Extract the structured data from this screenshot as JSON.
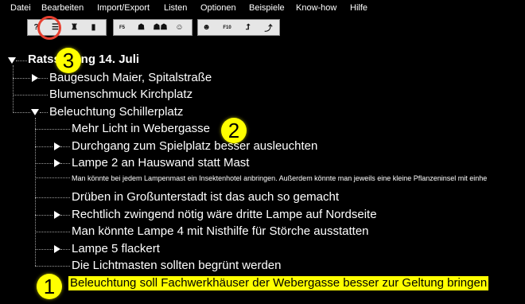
{
  "menu": [
    "Datei",
    "Bearbeiten",
    "Import/Export",
    "Listen",
    "Optionen",
    "Beispiele",
    "Know-how",
    "Hilfe"
  ],
  "toolbar": {
    "buttons": [
      {
        "name": "help-icon",
        "glyph": "?"
      },
      {
        "name": "list-view-icon",
        "glyph": "☰"
      },
      {
        "name": "tree-icon",
        "glyph": "♜"
      },
      {
        "name": "chart-icon",
        "glyph": "▮"
      },
      {
        "name": "f5-icon",
        "glyph": "F5"
      },
      {
        "name": "person-icon",
        "glyph": "☗"
      },
      {
        "name": "persons-icon",
        "glyph": "☗☗"
      },
      {
        "name": "face-icon",
        "glyph": "☺"
      },
      {
        "name": "portrait-icon",
        "glyph": "☻"
      },
      {
        "name": "f10-icon",
        "glyph": "F10"
      },
      {
        "name": "up-arrow-icon",
        "glyph": "⮥"
      },
      {
        "name": "tree-branch-icon",
        "glyph": "⤴"
      }
    ]
  },
  "tree": {
    "root": "Ratssitzung 14. Juli",
    "items": [
      {
        "label": "Baugesuch Maier, Spitalstraße"
      },
      {
        "label": "Blumenschmuck Kirchplatz"
      },
      {
        "label": "Beleuchtung Schillerplatz"
      },
      {
        "label": "Mehr Licht in Webergasse"
      },
      {
        "label": "Durchgang zum Spielplatz besser ausleuchten"
      },
      {
        "label": "Lampe 2 an Hauswand statt Mast"
      },
      {
        "label": "Man könnte bei jedem Lampenmast ein Insektenhotel anbringen. Außerdem könnte man jeweils eine kleine Pflanzeninsel mit einhe"
      },
      {
        "label": "Drüben in Großunterstadt ist das auch so gemacht"
      },
      {
        "label": "Rechtlich zwingend nötig wäre dritte Lampe auf Nordseite"
      },
      {
        "label": "Man könnte Lampe 4 mit Nisthilfe für Störche ausstatten"
      },
      {
        "label": "Lampe 5 flackert"
      },
      {
        "label": "Die Lichtmasten sollten begrünt werden"
      },
      {
        "label": "Beleuchtung soll Fachwerkhäuser der Webergasse besser zur Geltung bringen"
      }
    ]
  },
  "callouts": {
    "one": "1",
    "two": "2",
    "three": "3"
  }
}
